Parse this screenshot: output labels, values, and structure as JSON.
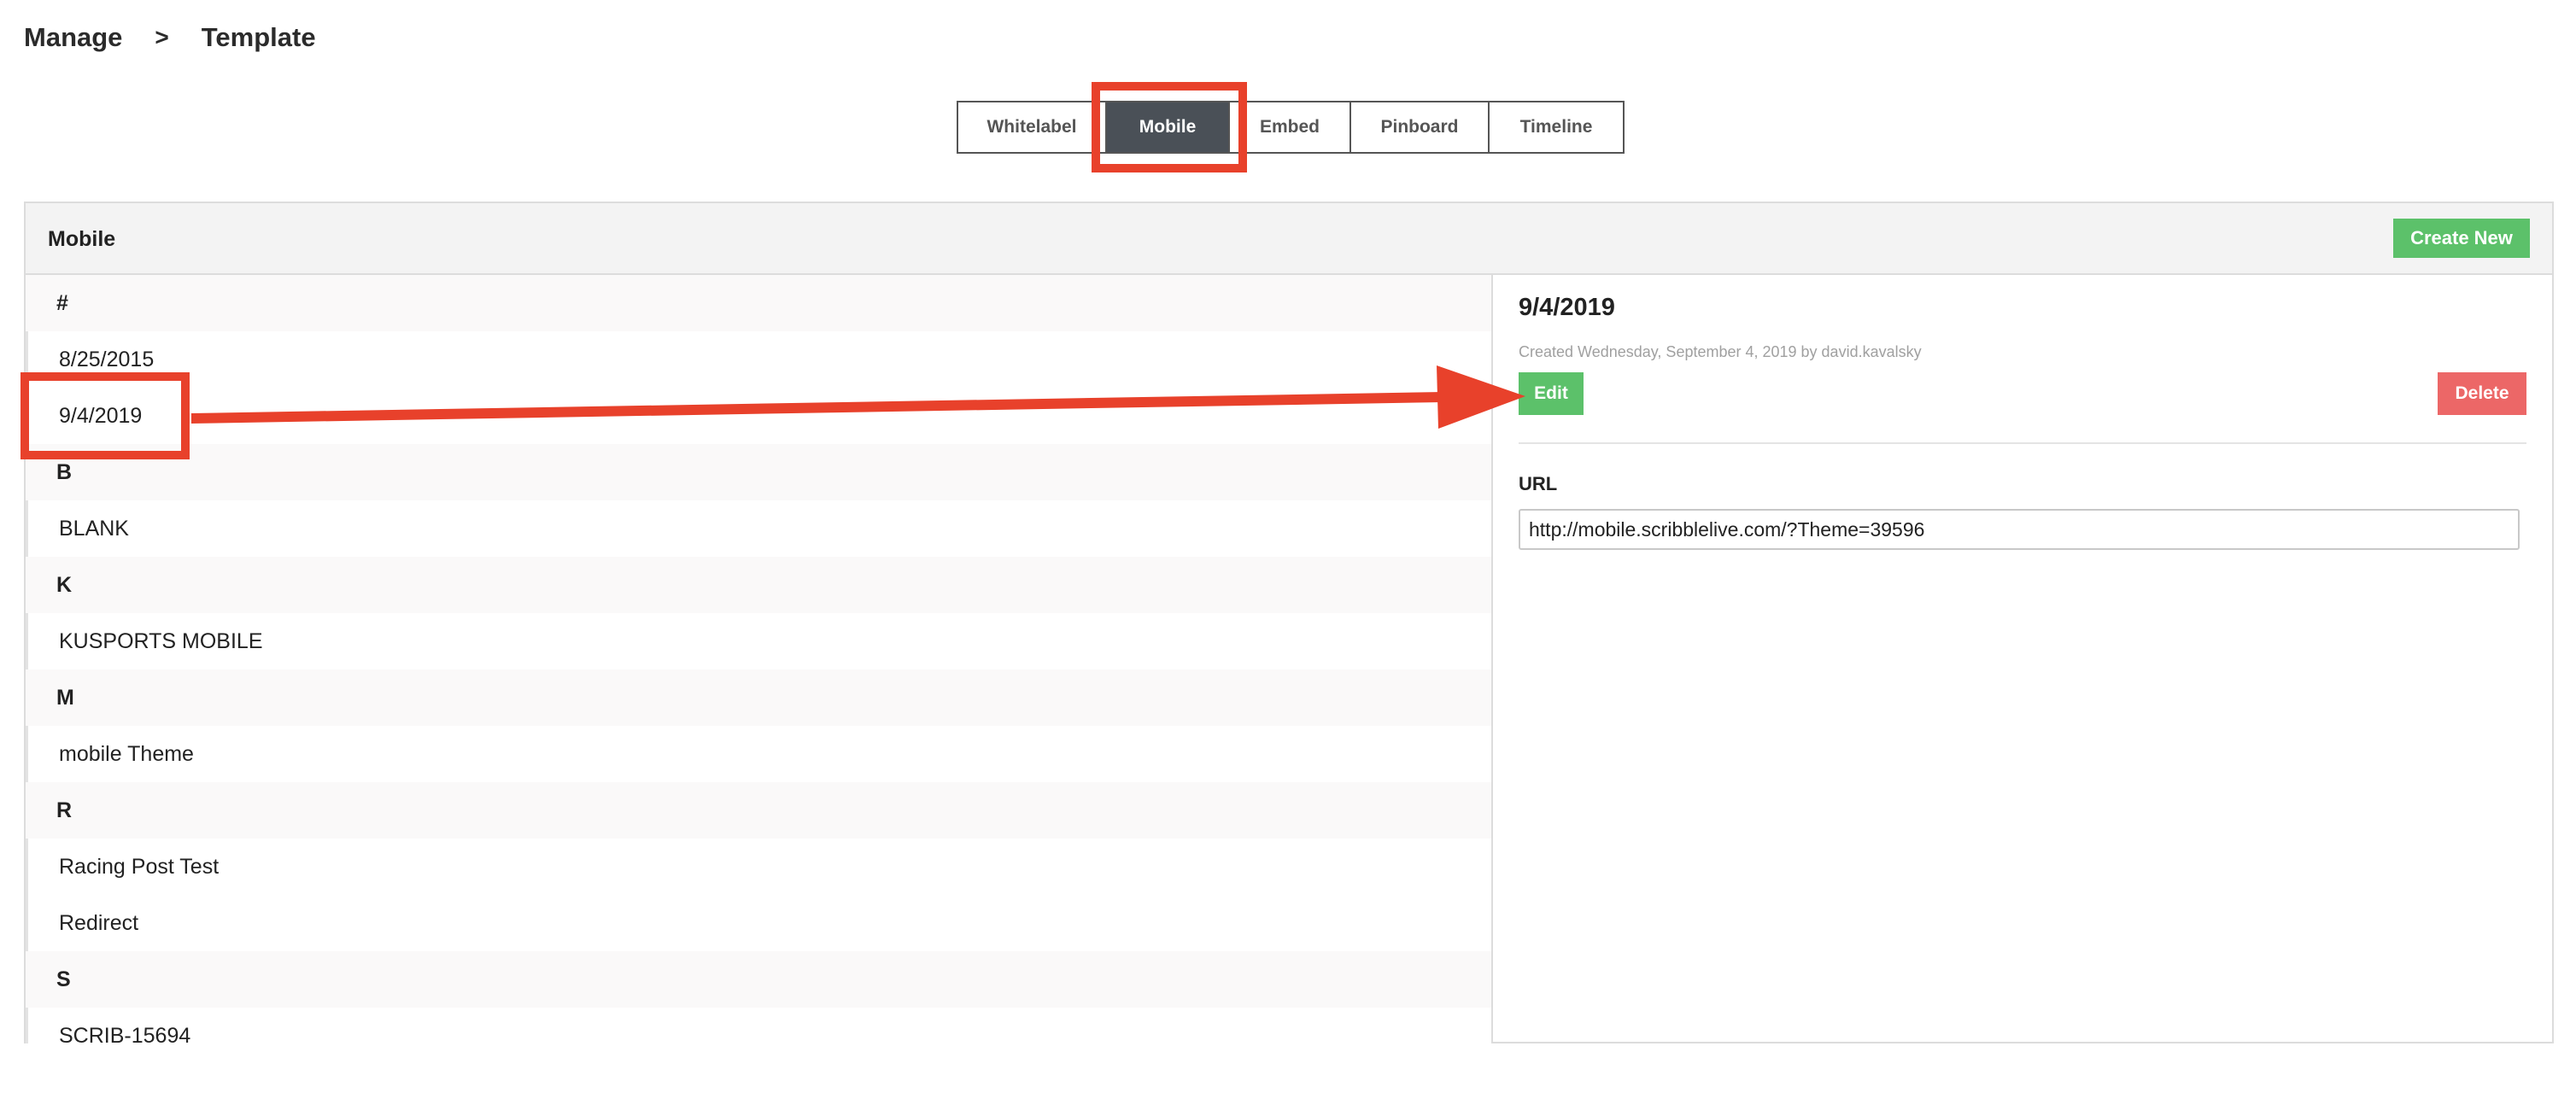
{
  "breadcrumb": {
    "root": "Manage",
    "separator": ">",
    "current": "Template"
  },
  "tabs": [
    {
      "label": "Whitelabel",
      "active": false
    },
    {
      "label": "Mobile",
      "active": true
    },
    {
      "label": "Embed",
      "active": false
    },
    {
      "label": "Pinboard",
      "active": false
    },
    {
      "label": "Timeline",
      "active": false
    }
  ],
  "panel": {
    "title": "Mobile",
    "create_label": "Create New"
  },
  "list": {
    "rows": [
      {
        "type": "letter",
        "text": "#"
      },
      {
        "type": "item",
        "text": "8/25/2015"
      },
      {
        "type": "item",
        "text": "9/4/2019"
      },
      {
        "type": "letter",
        "text": "B"
      },
      {
        "type": "item",
        "text": "BLANK"
      },
      {
        "type": "letter",
        "text": "K"
      },
      {
        "type": "item",
        "text": "KUSPORTS MOBILE"
      },
      {
        "type": "letter",
        "text": "M"
      },
      {
        "type": "item",
        "text": "mobile Theme"
      },
      {
        "type": "letter",
        "text": "R"
      },
      {
        "type": "item",
        "text": "Racing Post Test"
      },
      {
        "type": "item",
        "text": "Redirect"
      },
      {
        "type": "letter",
        "text": "S"
      },
      {
        "type": "item",
        "text": "SCRIB-15694"
      }
    ]
  },
  "detail": {
    "title": "9/4/2019",
    "meta": "Created Wednesday, September 4, 2019 by david.kavalsky",
    "edit_label": "Edit",
    "delete_label": "Delete",
    "url_label": "URL",
    "url_value": "http://mobile.scribblelive.com/?Theme=39596"
  },
  "colors": {
    "accent_green": "#5cc16a",
    "danger_red": "#ec6767",
    "annotation_red": "#e8412b",
    "active_tab": "#4a5057"
  }
}
